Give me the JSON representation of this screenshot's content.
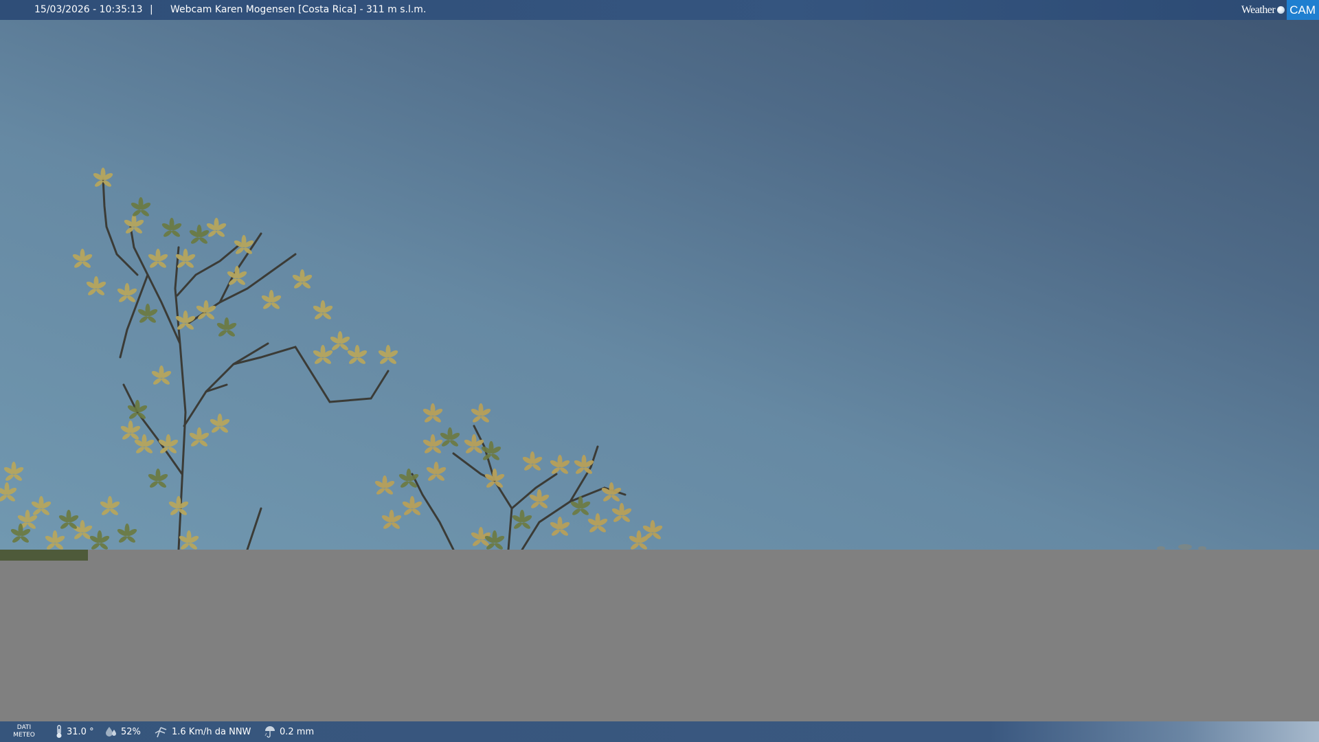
{
  "top_bar": {
    "datetime": "15/03/2026 - 10:35:13",
    "separator": "|",
    "title": "Webcam Karen Mogensen [Costa Rica]  - 311 m s.l.m.",
    "logo": {
      "word": "Weather",
      "cam": "CAM"
    }
  },
  "bottom_bar": {
    "label_line1": "DATI",
    "label_line2": "METEO",
    "temperature": {
      "icon": "thermometer-icon",
      "value": "31.0 °"
    },
    "humidity": {
      "icon": "humidity-icon",
      "value": "52%"
    },
    "wind": {
      "icon": "wind-icon",
      "value": "1.6 Km/h da NNW"
    },
    "rain": {
      "icon": "rain-icon",
      "value": "0.2 mm"
    }
  },
  "colors": {
    "bar": "#35557f",
    "logo_cam": "#1f7fd0",
    "sky_top": "#3e5572",
    "sky_bottom": "#7198b0",
    "mask": "#808080"
  }
}
